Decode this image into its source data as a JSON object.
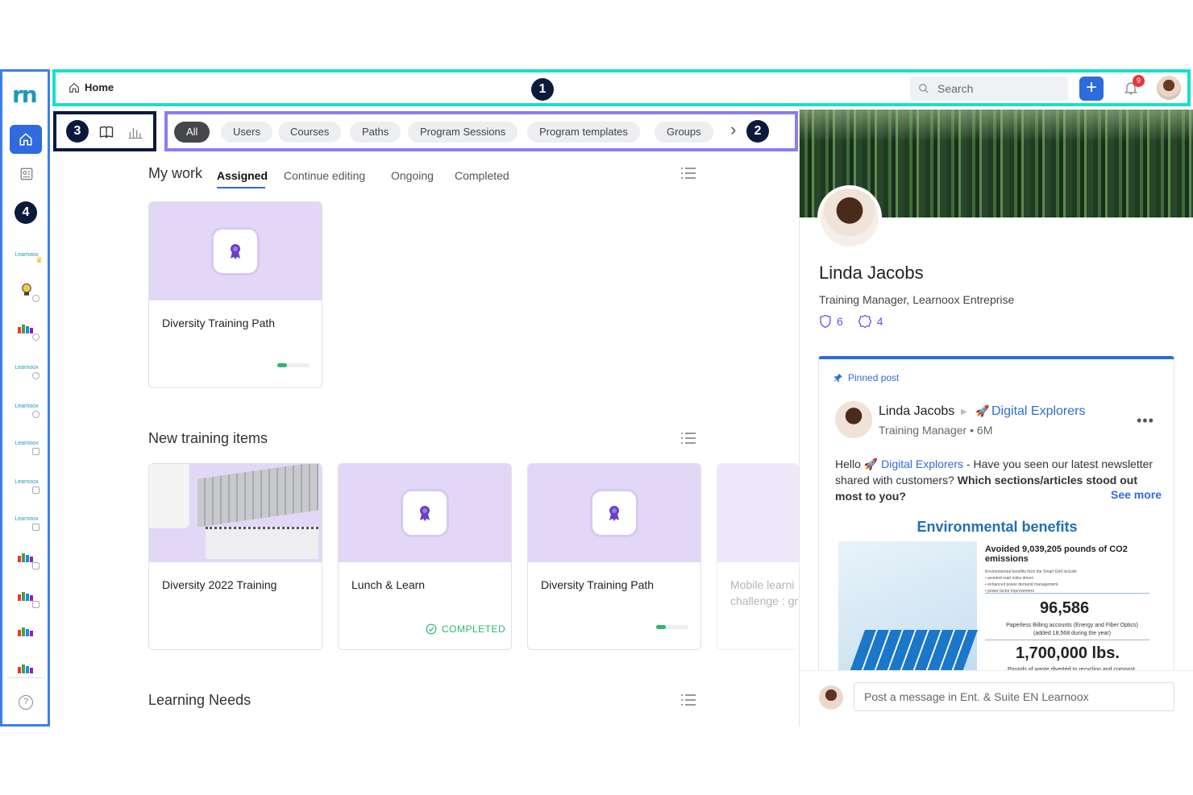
{
  "topbar": {
    "breadcrumb": "Home",
    "search_placeholder": "Search",
    "notification_count": "9"
  },
  "callouts": [
    "1",
    "2",
    "3",
    "4"
  ],
  "sidebar": {
    "logo": "rn",
    "items": [
      {
        "label": "Learnoox"
      },
      {
        "label": "Learnoox"
      },
      {
        "label": "Learnoox"
      },
      {
        "label": "Learnoox"
      },
      {
        "label": "Learnoox"
      },
      {
        "label": "Learnoox"
      }
    ],
    "help": "?"
  },
  "filters": [
    "All",
    "Users",
    "Courses",
    "Paths",
    "Program Sessions",
    "Program templates",
    "Groups"
  ],
  "my_work": {
    "title": "My work",
    "tabs": [
      "Assigned",
      "Continue editing",
      "Ongoing",
      "Completed"
    ],
    "cards": [
      {
        "title": "Diversity Training Path",
        "progress": 0.3
      }
    ]
  },
  "new_training": {
    "title": "New training items",
    "cards": [
      {
        "title": "Diversity 2022 Training"
      },
      {
        "title": "Lunch & Learn",
        "status": "COMPLETED"
      },
      {
        "title": "Diversity Training Path",
        "progress": 0.3
      },
      {
        "title": "Mobile learni challenge : gr"
      }
    ]
  },
  "learning_needs": {
    "title": "Learning Needs"
  },
  "profile": {
    "name": "Linda Jacobs",
    "role": "Training Manager, Learnoox Entreprise",
    "badges": "6",
    "skills": "4",
    "pinned_label": "Pinned post",
    "post": {
      "author": "Linda Jacobs",
      "group": "Digital Explorers",
      "subtitle": "Training Manager",
      "age": "6M",
      "text_prefix": "Hello",
      "text_group": "Digital Explorers",
      "text_body": "- Have you seen our latest newsletter shared with customers?",
      "text_bold": "Which sections/articles stood out most to you?",
      "see_more": "See more",
      "image": {
        "heading": "Environmental benefits",
        "stat1": "Avoided 9,039,205 pounds of CO2 emissions",
        "fine1": "Environmental benefits from the Smart Grid include:",
        "fine2": "• avoided road miles driven",
        "fine3": "• enhanced power demand management",
        "fine4": "• power factor improvement",
        "big1": "96,586",
        "small1": "Paperless Billing accounts (Energy and Fiber Optics) (added 18,568 during the year)",
        "big2": "1,700,000 lbs.",
        "small2": "Pounds of waste diverted to recycling and compost"
      }
    },
    "composer_placeholder": "Post a message in Ent. & Suite EN Learnoox"
  },
  "colors": {
    "accent": "#2f6bdc",
    "callout_1_border": "#17e0c8",
    "callout_2_border": "#8a7cf2",
    "callout_3_border": "#0b1a3a",
    "callout_4_border": "#3d7fe8",
    "progress": "#2bb673"
  }
}
